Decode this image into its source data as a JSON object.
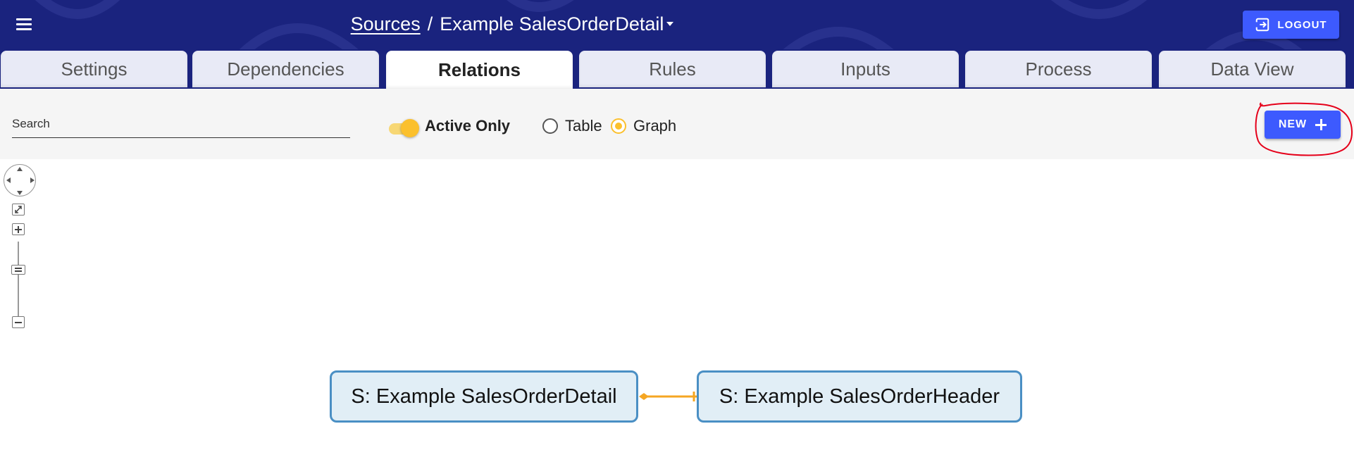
{
  "header": {
    "menu_icon": "hamburger-menu-icon",
    "breadcrumb_parent": "Sources",
    "breadcrumb_separator": "/",
    "breadcrumb_current": "Example SalesOrderDetail",
    "logout_label": "LOGOUT",
    "logout_icon": "logout-icon",
    "background_color": "#1a237e"
  },
  "tabs": [
    {
      "label": "Settings"
    },
    {
      "label": "Dependencies"
    },
    {
      "label": "Relations",
      "active": true
    },
    {
      "label": "Rules"
    },
    {
      "label": "Inputs"
    },
    {
      "label": "Process"
    },
    {
      "label": "Data View"
    }
  ],
  "toolbar": {
    "search_placeholder": "Search",
    "search_value": "",
    "active_only_label": "Active Only",
    "active_only_checked": true,
    "view_options": [
      {
        "label": "Table",
        "selected": false
      },
      {
        "label": "Graph",
        "selected": true
      }
    ],
    "new_label": "NEW",
    "new_icon": "plus-icon"
  },
  "graph": {
    "nodes": [
      {
        "label": "S: Example SalesOrderDetail"
      },
      {
        "label": "S: Example SalesOrderHeader"
      }
    ],
    "edge_color": "#f5a623",
    "node_border_color": "#4a8fc4",
    "node_fill_color": "#e1eef6"
  },
  "colors": {
    "accent": "#3d5afe",
    "toggle": "#fbc02d",
    "annotation": "#e5001a"
  }
}
